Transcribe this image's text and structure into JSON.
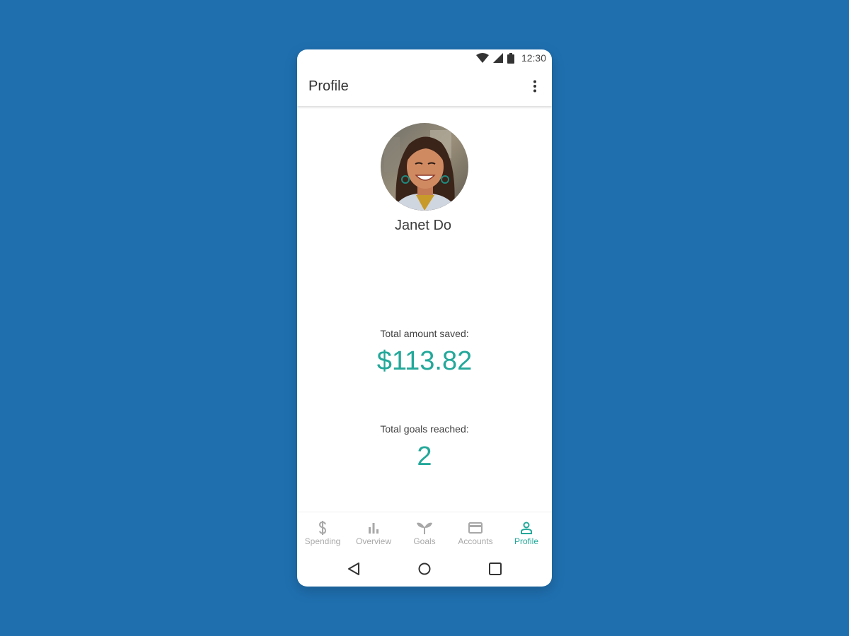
{
  "status_bar": {
    "time": "12:30",
    "icons": [
      "wifi-icon",
      "signal-icon",
      "battery-icon"
    ]
  },
  "app_bar": {
    "title": "Profile",
    "menu_icon": "more-vert-icon"
  },
  "profile": {
    "name": "Janet Do",
    "avatar_icon": "avatar-photo"
  },
  "stats": {
    "saved_label": "Total amount saved:",
    "saved_value": "$113.82",
    "goals_label": "Total goals reached:",
    "goals_value": "2"
  },
  "bottom_nav": {
    "items": [
      {
        "label": "Spending",
        "icon": "dollar-icon",
        "active": false
      },
      {
        "label": "Overview",
        "icon": "bar-chart-icon",
        "active": false
      },
      {
        "label": "Goals",
        "icon": "sprout-icon",
        "active": false
      },
      {
        "label": "Accounts",
        "icon": "credit-card-icon",
        "active": false
      },
      {
        "label": "Profile",
        "icon": "person-icon",
        "active": true
      }
    ]
  },
  "system_nav": {
    "icons": [
      "back-icon",
      "home-icon",
      "recents-icon"
    ]
  },
  "colors": {
    "background": "#1f6faf",
    "accent": "#23a89a",
    "inactive": "#a8a8a8"
  }
}
